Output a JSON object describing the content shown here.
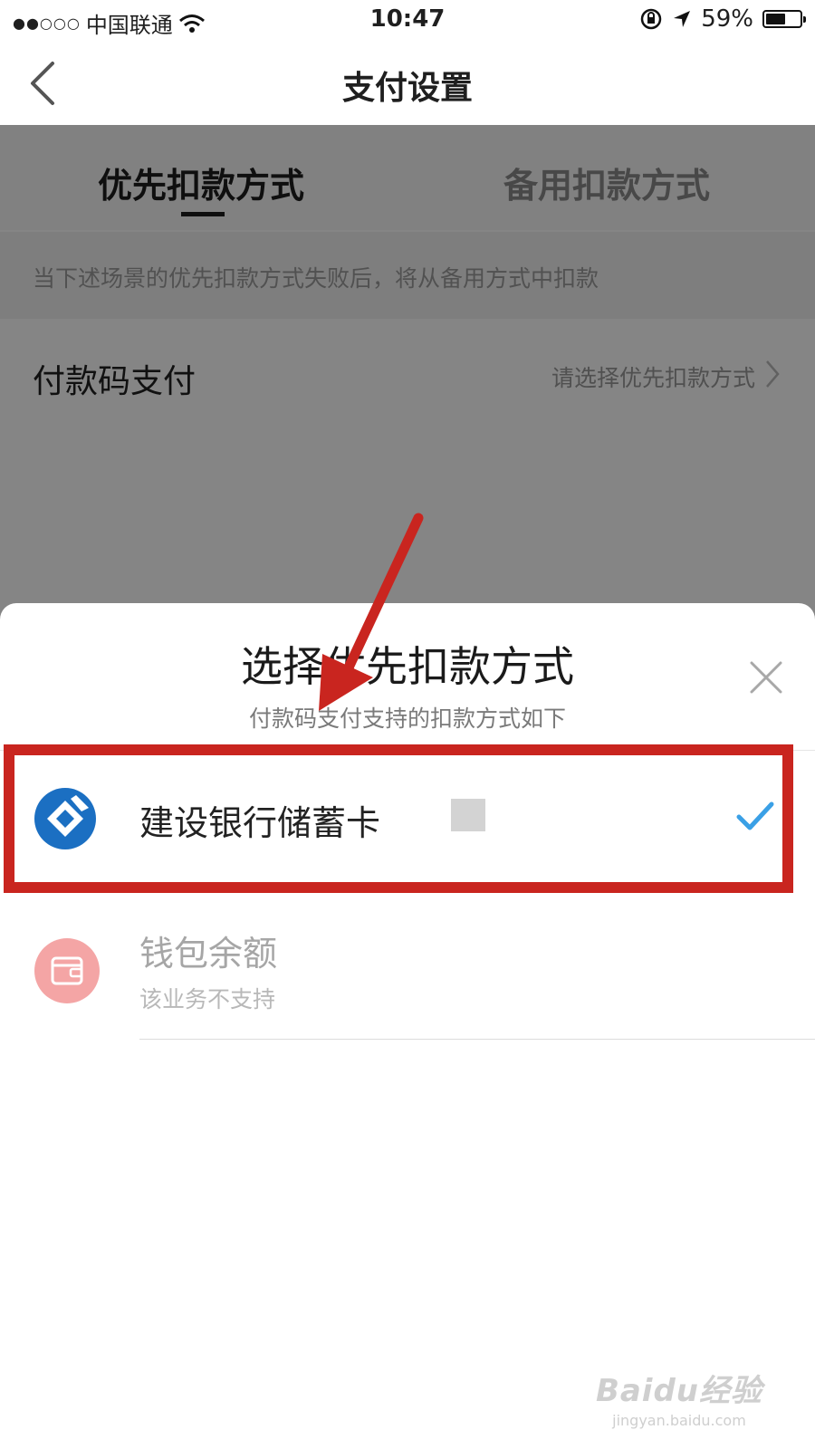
{
  "status_bar": {
    "carrier": "中国联通",
    "time": "10:47",
    "battery": "59%",
    "battery_level": 0.59,
    "icons": [
      "signal-dots-icon",
      "wifi-icon",
      "orientation-lock-icon",
      "location-arrow-icon",
      "battery-icon"
    ]
  },
  "nav": {
    "title": "支付设置",
    "back_icon": "chevron-left-icon"
  },
  "tabs": [
    {
      "label": "优先扣款方式",
      "active": true
    },
    {
      "label": "备用扣款方式",
      "active": false
    }
  ],
  "hint_text": "当下述场景的优先扣款方式失败后，将从备用方式中扣款",
  "payment_code_row": {
    "label": "付款码支付",
    "value": "请选择优先扣款方式"
  },
  "sheet": {
    "title": "选择优先扣款方式",
    "subtitle": "付款码支付支持的扣款方式如下",
    "close_icon": "close-icon",
    "options": [
      {
        "name": "建设银行储蓄卡",
        "selected": true,
        "icon": "ccb-bank-icon"
      },
      {
        "name": "钱包余额",
        "subtitle": "该业务不支持",
        "disabled": true,
        "icon": "wallet-icon"
      }
    ]
  },
  "colors": {
    "accent_check": "#3aa0e6",
    "ccb_blue": "#1b6fc2",
    "wallet_pink": "#f4a5a5",
    "annotation_red": "#c9251f"
  },
  "watermark": {
    "main": "Baidu经验",
    "sub": "jingyan.baidu.com"
  }
}
